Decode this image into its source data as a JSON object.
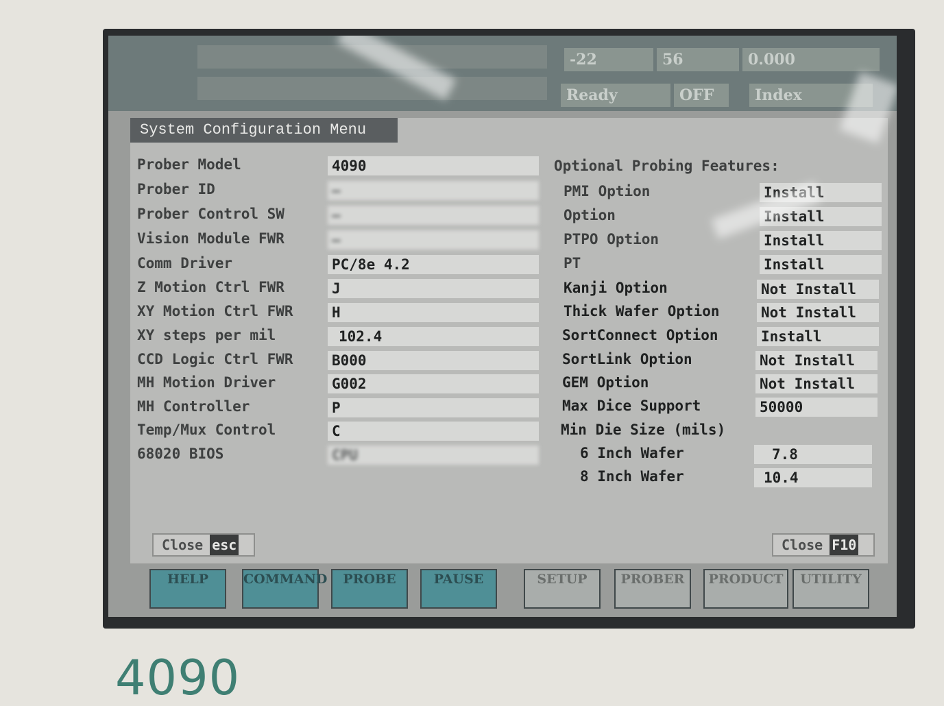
{
  "status_bar": {
    "ready": "Ready",
    "off": "OFF",
    "index": "Index",
    "num1": "-22",
    "num2": "56",
    "num3": "0.000"
  },
  "dialog": {
    "title": "System Configuration Menu",
    "left_rows": [
      {
        "label": "Prober Model",
        "value": "4090"
      },
      {
        "label": "Prober ID",
        "value": "—"
      },
      {
        "label": "Prober Control SW",
        "value": "—"
      },
      {
        "label": "Vision Module FWR",
        "value": "—"
      },
      {
        "label": "Comm Driver",
        "value": "PC/8e 4.2"
      },
      {
        "label": "Z Motion Ctrl FWR",
        "value": "J"
      },
      {
        "label": "XY Motion Ctrl FWR",
        "value": "H"
      },
      {
        "label": "XY steps per mil",
        "value": "102.4"
      },
      {
        "label": "CCD Logic Ctrl FWR",
        "value": "B000"
      },
      {
        "label": "MH Motion Driver",
        "value": "G002"
      },
      {
        "label": "MH Controller",
        "value": "P"
      },
      {
        "label": "Temp/Mux Control",
        "value": "C"
      },
      {
        "label": "68020 BIOS",
        "value": "CPU"
      }
    ],
    "optional_header": "Optional Probing Features:",
    "right_rows": [
      {
        "label": "PMI Option",
        "value": "Install"
      },
      {
        "label": "Option",
        "value": "Install"
      },
      {
        "label": "PTPO Option",
        "value": "Install"
      },
      {
        "label": "PT",
        "value": "Install"
      },
      {
        "label": "Kanji Option",
        "value": "Not Install"
      },
      {
        "label": "Thick Wafer Option",
        "value": "Not Install"
      },
      {
        "label": "SortConnect Option",
        "value": "Install"
      },
      {
        "label": "SortLink Option",
        "value": "Not Install"
      },
      {
        "label": "GEM Option",
        "value": "Not Install"
      },
      {
        "label": "Max Dice Support",
        "value": "50000"
      }
    ],
    "min_die_header": "Min Die Size (mils)",
    "die_rows": [
      {
        "label": "6 Inch Wafer",
        "value": "7.8"
      },
      {
        "label": "8 Inch Wafer",
        "value": "10.4"
      }
    ],
    "close_left": "Close",
    "close_left_key": "esc",
    "close_right": "Close",
    "close_right_key": "F10"
  },
  "tabs": [
    "HELP",
    "COMMAND",
    "PROBE",
    "PAUSE",
    "SETUP",
    "PROBER",
    "PRODUCT",
    "UTILITY"
  ],
  "device_model": "4090"
}
